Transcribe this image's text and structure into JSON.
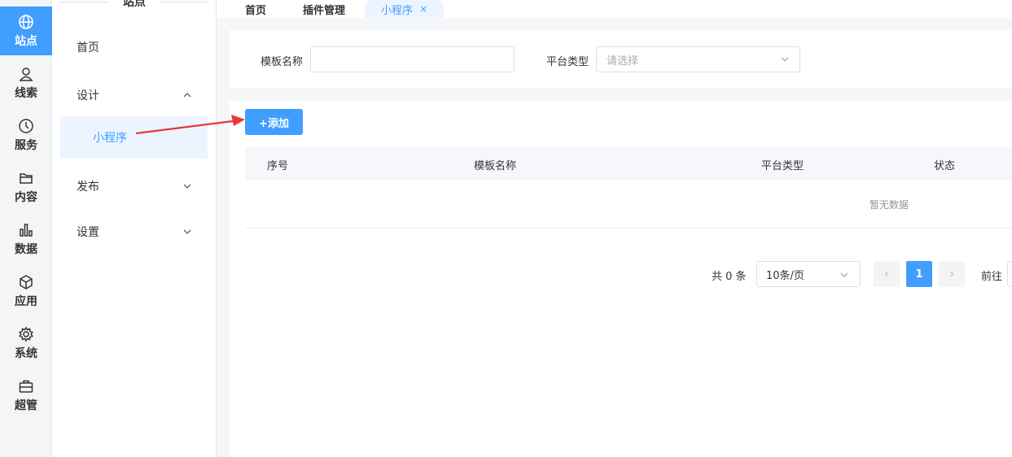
{
  "rail": {
    "items": [
      {
        "label": "站点",
        "icon": "globe-icon"
      },
      {
        "label": "线索",
        "icon": "user-icon"
      },
      {
        "label": "服务",
        "icon": "clock-icon"
      },
      {
        "label": "内容",
        "icon": "folder-icon"
      },
      {
        "label": "数据",
        "icon": "bar-chart-icon"
      },
      {
        "label": "应用",
        "icon": "cube-icon"
      },
      {
        "label": "系统",
        "icon": "gear-icon"
      },
      {
        "label": "超管",
        "icon": "briefcase-icon"
      }
    ],
    "active_color": "#409eff"
  },
  "submenu": {
    "title": "站点",
    "items": {
      "home": "首页",
      "design": "设计",
      "design_child": "小程序",
      "publish": "发布",
      "settings": "设置"
    }
  },
  "tabs": {
    "home": "首页",
    "plugins": "插件管理",
    "miniapp": "小程序",
    "close_glyph": "×"
  },
  "filter": {
    "template_name_label": "模板名称",
    "template_name_value": "",
    "platform_label": "平台类型",
    "platform_placeholder": "请选择"
  },
  "toolbar": {
    "add_label": "+添加"
  },
  "table": {
    "columns": [
      "序号",
      "模板名称",
      "平台类型",
      "状态"
    ],
    "empty_text": "暂无数据"
  },
  "pagination": {
    "total_text": "共 0 条",
    "page_size": "10条/页",
    "current_page": "1",
    "goto_label": "前往"
  },
  "annotation": {
    "arrow_color": "#e53935"
  }
}
